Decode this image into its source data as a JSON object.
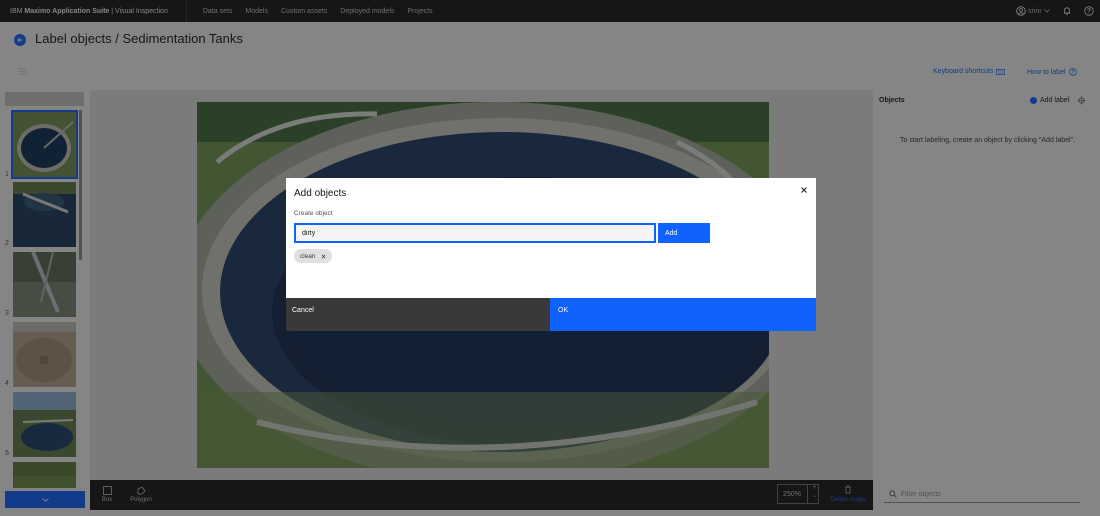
{
  "header": {
    "brand_prefix": "IBM",
    "brand_bold": "Maximo Application Suite",
    "brand_suffix": "| Visual Inspection",
    "nav": [
      "Data sets",
      "Models",
      "Custom assets",
      "Deployed models",
      "Projects"
    ],
    "user": "srini"
  },
  "page": {
    "title": "Label objects / Sedimentation Tanks",
    "keyboard_shortcuts": "Keyboard shortcuts",
    "how_to_label": "How to label"
  },
  "thumbnails": {
    "numbers": [
      "1",
      "2",
      "3",
      "4",
      "5"
    ],
    "selected_index": 1
  },
  "tools": {
    "box": "Box",
    "polygon": "Polygon",
    "zoom": "250%",
    "delete_image": "Delete image"
  },
  "panel": {
    "title": "Objects",
    "add_label": "Add label",
    "empty_message": "To start labeling, create an object by clicking \"Add label\".",
    "filter_placeholder": "Filter objects"
  },
  "modal": {
    "title": "Add objects",
    "create_label": "Create object",
    "input_value": "dirty",
    "add_button": "Add",
    "tags": [
      "clean"
    ],
    "cancel": "Cancel",
    "ok": "OK"
  },
  "colors": {
    "accent": "#0f62fe",
    "topbar": "#161616"
  }
}
